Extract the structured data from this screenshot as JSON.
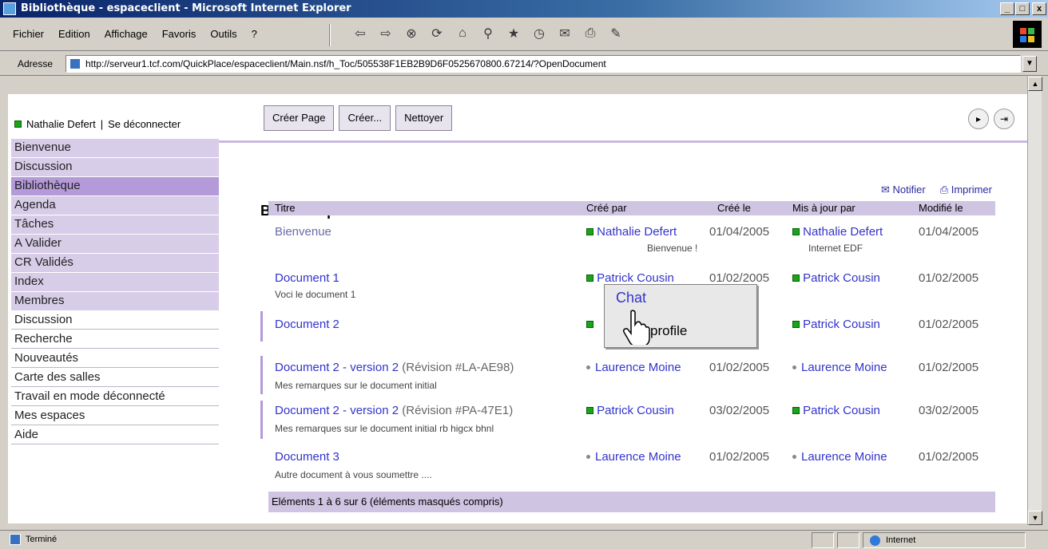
{
  "window": {
    "title": "Bibliothèque - espaceclient - Microsoft Internet Explorer",
    "controls": [
      "_",
      "□",
      "x"
    ]
  },
  "menu": {
    "items": [
      "Fichier",
      "Edition",
      "Affichage",
      "Favoris",
      "Outils",
      "?"
    ]
  },
  "toolbar_icons": [
    "back-icon",
    "forward-icon",
    "stop-icon",
    "refresh-icon",
    "home-icon",
    "search-icon",
    "favorites-icon",
    "history-icon",
    "mail-icon",
    "print-icon",
    "edit-icon"
  ],
  "address": {
    "label": "Adresse",
    "url": "http://serveur1.tcf.com/QuickPlace/espaceclient/Main.nsf/h_Toc/505538F1EB2B9D6F0525670800.67214/?OpenDocument"
  },
  "user": {
    "name": "Nathalie Defert",
    "separator": "|",
    "logout": "Se déconnecter"
  },
  "actions": [
    "Créer Page",
    "Créer...",
    "Nettoyer"
  ],
  "sidebar": {
    "items": [
      {
        "label": "Bienvenue",
        "style": "purple"
      },
      {
        "label": "Discussion",
        "style": "purple"
      },
      {
        "label": "Bibliothèque",
        "style": "active"
      },
      {
        "label": "Agenda",
        "style": "purple"
      },
      {
        "label": "Tâches",
        "style": "purple"
      },
      {
        "label": "A Valider",
        "style": "purple"
      },
      {
        "label": "CR Validés",
        "style": "purple"
      },
      {
        "label": "Index",
        "style": "purple"
      },
      {
        "label": "Membres",
        "style": "purple"
      },
      {
        "label": "Discussion",
        "style": "plain"
      },
      {
        "label": "Recherche",
        "style": "plain"
      },
      {
        "label": "Nouveautés",
        "style": "plain"
      },
      {
        "label": "Carte des salles",
        "style": "plain"
      },
      {
        "label": "Travail en mode déconnecté",
        "style": "plain"
      },
      {
        "label": "Mes espaces",
        "style": "plain"
      },
      {
        "label": "Aide",
        "style": "plain"
      }
    ]
  },
  "page": {
    "notify": "Notifier",
    "print": "Imprimer",
    "title": "Bibliothèque"
  },
  "table": {
    "headers": [
      "Titre",
      "Créé par",
      "Créé le",
      "Mis à jour par",
      "Modifié le"
    ],
    "rows": [
      {
        "title": "Bienvenue",
        "revision": "",
        "sub": "",
        "created_by": "Nathalie Defert",
        "created_note": "Bienvenue !",
        "created_on": "01/04/2005",
        "updated_by": "Nathalie Defert",
        "updated_note": "Internet EDF",
        "modified": "01/04/2005",
        "marker": "green"
      },
      {
        "title": "Document 1",
        "revision": "",
        "sub": "Voci le document 1",
        "created_by": "Patrick Cousin",
        "created_note": "",
        "created_on": "01/02/2005",
        "updated_by": "Patrick Cousin",
        "updated_note": "",
        "modified": "01/02/2005",
        "marker": "green"
      },
      {
        "title": "Document 2",
        "revision": "",
        "sub": "",
        "created_by": "",
        "created_note": "",
        "created_on": "005",
        "updated_by": "Patrick Cousin",
        "updated_note": "",
        "modified": "01/02/2005",
        "marker": "green"
      },
      {
        "title": "Document 2 - version 2",
        "revision": "(Révision #LA-AE98)",
        "sub": "Mes remarques sur le document initial",
        "created_by": "Laurence Moine",
        "created_note": "",
        "created_on": "01/02/2005",
        "updated_by": "Laurence Moine",
        "updated_note": "",
        "modified": "01/02/2005",
        "marker": "dot"
      },
      {
        "title": "Document 2 - version 2",
        "revision": "(Révision #PA-47E1)",
        "sub": "Mes remarques sur le document initial rb higcx bhnl",
        "created_by": "Patrick Cousin",
        "created_note": "",
        "created_on": "03/02/2005",
        "updated_by": "Patrick Cousin",
        "updated_note": "",
        "modified": "03/02/2005",
        "marker": "green"
      },
      {
        "title": "Document 3",
        "revision": "",
        "sub": "Autre document à vous soumettre ....",
        "created_by": "Laurence Moine",
        "created_note": "",
        "created_on": "01/02/2005",
        "updated_by": "Laurence Moine",
        "updated_note": "",
        "modified": "01/02/2005",
        "marker": "dot"
      }
    ],
    "footer": "Eléments 1 à 6 sur 6 (éléments masqués compris)"
  },
  "popup": {
    "chat": "Chat",
    "profile": "w profile"
  },
  "status": {
    "text": "Terminé",
    "zone": "Internet"
  },
  "colors": {
    "accent": "#b49ad8",
    "sidebar": "#d8cde8",
    "link": "#3333cc",
    "online": "#17a617"
  }
}
